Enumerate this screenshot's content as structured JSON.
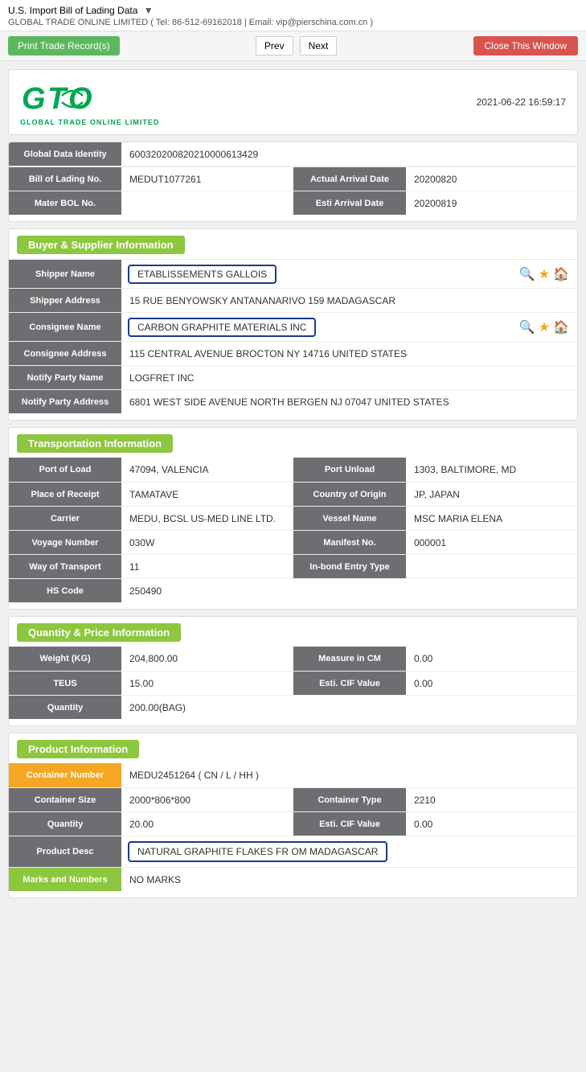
{
  "page": {
    "title": "U.S. Import Bill of Lading Data",
    "subtitle": "GLOBAL TRADE ONLINE LIMITED ( Tel: 86-512-69162018 | Email: vip@pierschina.com.cn )",
    "timestamp": "2021-06-22 16:59:17"
  },
  "toolbar": {
    "print_label": "Print Trade Record(s)",
    "prev_label": "Prev",
    "next_label": "Next",
    "close_label": "Close This Window"
  },
  "logo": {
    "text": "GTO",
    "sub": "GLOBAL TRADE  ONLINE LIMITED"
  },
  "identity": {
    "global_data_identity_label": "Global Data Identity",
    "global_data_identity_value": "600320200820210000613429",
    "bill_of_lading_no_label": "Bill of Lading No.",
    "bill_of_lading_no_value": "MEDUT1077261",
    "actual_arrival_date_label": "Actual Arrival Date",
    "actual_arrival_date_value": "20200820",
    "mater_bol_label": "Mater BOL No.",
    "mater_bol_value": "",
    "esti_arrival_date_label": "Esti Arrival Date",
    "esti_arrival_date_value": "20200819"
  },
  "buyer_supplier": {
    "section_label": "Buyer & Supplier Information",
    "shipper_name_label": "Shipper Name",
    "shipper_name_value": "ETABLISSEMENTS GALLOIS",
    "shipper_address_label": "Shipper Address",
    "shipper_address_value": "15 RUE BENYOWSKY ANTANANARIVO 159 MADAGASCAR",
    "consignee_name_label": "Consignee Name",
    "consignee_name_value": "CARBON GRAPHITE MATERIALS INC",
    "consignee_address_label": "Consignee Address",
    "consignee_address_value": "115 CENTRAL AVENUE BROCTON NY 14716 UNITED STATES",
    "notify_party_name_label": "Notify Party Name",
    "notify_party_name_value": "LOGFRET INC",
    "notify_party_address_label": "Notify Party Address",
    "notify_party_address_value": "6801 WEST SIDE AVENUE NORTH BERGEN NJ 07047 UNITED STATES"
  },
  "transportation": {
    "section_label": "Transportation Information",
    "port_of_load_label": "Port of Load",
    "port_of_load_value": "47094, VALENCIA",
    "port_unload_label": "Port Unload",
    "port_unload_value": "1303, BALTIMORE, MD",
    "place_of_receipt_label": "Place of Receipt",
    "place_of_receipt_value": "TAMATAVE",
    "country_of_origin_label": "Country of Origin",
    "country_of_origin_value": "JP, JAPAN",
    "carrier_label": "Carrier",
    "carrier_value": "MEDU, BCSL US-MED LINE LTD.",
    "vessel_name_label": "Vessel Name",
    "vessel_name_value": "MSC MARIA ELENA",
    "voyage_number_label": "Voyage Number",
    "voyage_number_value": "030W",
    "manifest_no_label": "Manifest No.",
    "manifest_no_value": "000001",
    "way_of_transport_label": "Way of Transport",
    "way_of_transport_value": "11",
    "inbond_entry_type_label": "In-bond Entry Type",
    "inbond_entry_type_value": "",
    "hs_code_label": "HS Code",
    "hs_code_value": "250490"
  },
  "quantity_price": {
    "section_label": "Quantity & Price Information",
    "weight_kg_label": "Weight (KG)",
    "weight_kg_value": "204,800.00",
    "measure_in_cm_label": "Measure in CM",
    "measure_in_cm_value": "0.00",
    "teus_label": "TEUS",
    "teus_value": "15.00",
    "esti_cif_value_label": "Esti. CIF Value",
    "esti_cif_value_value": "0.00",
    "quantity_label": "Quantity",
    "quantity_value": "200.00(BAG)"
  },
  "product_information": {
    "section_label": "Product Information",
    "container_number_label": "Container Number",
    "container_number_value": "MEDU2451264 ( CN / L / HH )",
    "container_size_label": "Container Size",
    "container_size_value": "2000*806*800",
    "container_type_label": "Container Type",
    "container_type_value": "2210",
    "quantity_label": "Quantity",
    "quantity_value": "20.00",
    "esti_cif_label": "Esti. CIF Value",
    "esti_cif_value": "0.00",
    "product_desc_label": "Product Desc",
    "product_desc_value": "NATURAL GRAPHITE FLAKES FR OM MADAGASCAR",
    "marks_and_numbers_label": "Marks and Numbers",
    "marks_and_numbers_value": "NO MARKS"
  }
}
